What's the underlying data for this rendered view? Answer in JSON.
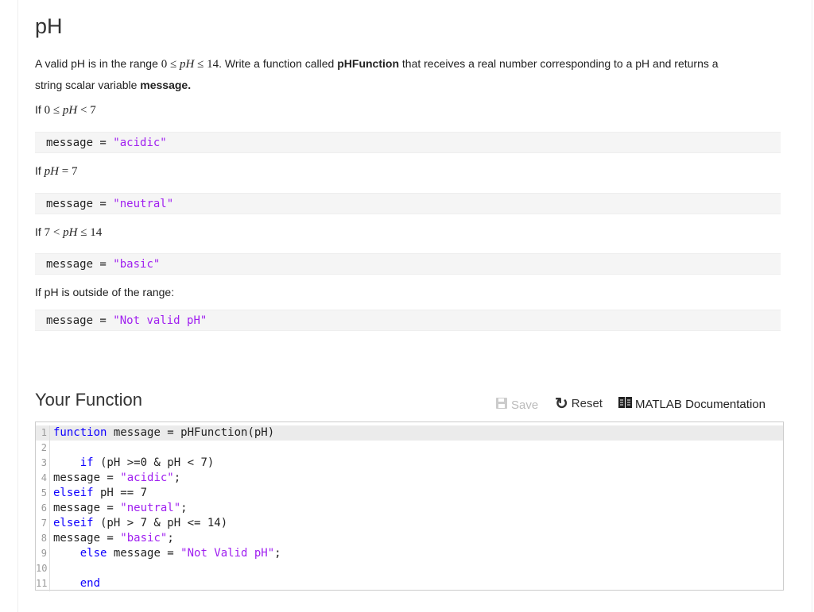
{
  "title": "pH",
  "intro": {
    "t1": "A valid pH is in the range ",
    "math_range": [
      "0 ≤ ",
      "pH",
      " ≤ 14"
    ],
    "t2": ". Write a function called ",
    "fn_name": "pHFunction",
    "t3": " that receives a real number corresponding to a pH and returns a",
    "t4": "string scalar variable ",
    "var_name": "message."
  },
  "cases": [
    {
      "prefix": "If ",
      "math_pre": "0 ≤ ",
      "math_var": "pH",
      "math_post": " < 7",
      "code_var": "message = ",
      "code_str": "\"acidic\""
    },
    {
      "prefix": "If ",
      "math_pre": "",
      "math_var": "pH",
      "math_post": " = 7",
      "code_var": "message = ",
      "code_str": "\"neutral\""
    },
    {
      "prefix": "If ",
      "math_pre": "7 < ",
      "math_var": "pH",
      "math_post": " ≤ 14",
      "code_var": "message = ",
      "code_str": "\"basic\""
    },
    {
      "prefix": "If pH is outside of the range:",
      "math_pre": "",
      "math_var": "",
      "math_post": "",
      "code_var": "message = ",
      "code_str": "\"Not valid pH\""
    }
  ],
  "section_title": "Your Function",
  "toolbar": {
    "save_label": "Save",
    "reset_label": "Reset",
    "docs_label": "MATLAB Documentation"
  },
  "editor": {
    "lines": [
      {
        "num": "1",
        "parts": [
          [
            "kw",
            "function"
          ],
          [
            "",
            " message = pHFunction(pH)"
          ]
        ]
      },
      {
        "num": "2",
        "parts": []
      },
      {
        "num": "3",
        "parts": [
          [
            "",
            "    "
          ],
          [
            "kw",
            "if"
          ],
          [
            "",
            " (pH >=0 & pH < 7)"
          ]
        ]
      },
      {
        "num": "4",
        "parts": [
          [
            "",
            "message = "
          ],
          [
            "str",
            "\"acidic\""
          ],
          [
            "",
            ";"
          ]
        ]
      },
      {
        "num": "5",
        "parts": [
          [
            "kw",
            "elseif"
          ],
          [
            "",
            " pH == 7"
          ]
        ]
      },
      {
        "num": "6",
        "parts": [
          [
            "",
            "message = "
          ],
          [
            "str",
            "\"neutral\""
          ],
          [
            "",
            ";"
          ]
        ]
      },
      {
        "num": "7",
        "parts": [
          [
            "kw",
            "elseif"
          ],
          [
            "",
            " (pH > 7 & pH <= 14)"
          ]
        ]
      },
      {
        "num": "8",
        "parts": [
          [
            "",
            "message = "
          ],
          [
            "str",
            "\"basic\""
          ],
          [
            "",
            ";"
          ]
        ]
      },
      {
        "num": "9",
        "parts": [
          [
            "",
            "    "
          ],
          [
            "kw",
            "else"
          ],
          [
            "",
            " message = "
          ],
          [
            "str",
            "\"Not Valid pH\""
          ],
          [
            "",
            ";"
          ]
        ]
      },
      {
        "num": "10",
        "parts": []
      },
      {
        "num": "11",
        "parts": [
          [
            "",
            "    "
          ],
          [
            "kw",
            "end"
          ]
        ]
      }
    ]
  }
}
